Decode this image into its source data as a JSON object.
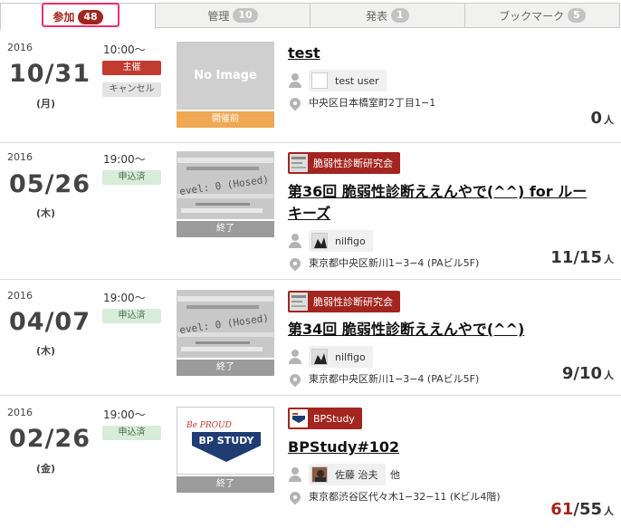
{
  "tabs": [
    {
      "label": "参加",
      "count": "48"
    },
    {
      "label": "管理",
      "count": "10"
    },
    {
      "label": "発表",
      "count": "1"
    },
    {
      "label": "ブックマーク",
      "count": "5"
    }
  ],
  "events": [
    {
      "year": "2016",
      "date": "10/31",
      "dow": "(月)",
      "time": "10:00〜",
      "tags": [
        "主催",
        "キャンセル"
      ],
      "thumb_text": "No Image",
      "status": "開催前",
      "group": "",
      "title": "test",
      "user": "test user",
      "extra": "",
      "address": "中央区日本橋室町2丁目1−1",
      "count_joined": "0",
      "count_sep": "",
      "count_capacity": "",
      "count_unit": "人"
    },
    {
      "year": "2016",
      "date": "05/26",
      "dow": "(木)",
      "time": "19:00〜",
      "tags": [
        "申込済"
      ],
      "thumb_text": "evel: 0 (Hosed)",
      "status": "終了",
      "group": "脆弱性診断研究会",
      "title": "第36回 脆弱性診断ええんやで(^^) for ルーキーズ",
      "user": "nilfigo",
      "extra": "",
      "address": "東京都中央区新川1−3−4 (PAビル5F)",
      "count_joined": "11",
      "count_sep": "/",
      "count_capacity": "15",
      "count_unit": "人"
    },
    {
      "year": "2016",
      "date": "04/07",
      "dow": "(木)",
      "time": "19:00〜",
      "tags": [
        "申込済"
      ],
      "thumb_text": "evel: 0 (Hosed)",
      "status": "終了",
      "group": "脆弱性診断研究会",
      "title": "第34回 脆弱性診断ええんやで(^^)",
      "user": "nilfigo",
      "extra": "",
      "address": "東京都中央区新川1−3−4 (PAビル5F)",
      "count_joined": "9",
      "count_sep": "/",
      "count_capacity": "10",
      "count_unit": "人"
    },
    {
      "year": "2016",
      "date": "02/26",
      "dow": "(金)",
      "time": "19:00〜",
      "tags": [
        "申込済"
      ],
      "thumb_text": "BP STUDY",
      "thumb_sub": "Be PROUD",
      "status": "終了",
      "group": "BPStudy",
      "title": "BPStudy#102",
      "user": "佐藤 治夫",
      "extra": "他",
      "address": "東京都渋谷区代々木1−32−11 (Kビル4階)",
      "count_joined": "61",
      "count_sep": "/",
      "count_capacity": "55",
      "count_unit": "人"
    }
  ],
  "colors": {
    "accent": "#a3251f",
    "highlight": "#e8336d",
    "pending": "#f0a852",
    "ended": "#9b9b9b"
  }
}
